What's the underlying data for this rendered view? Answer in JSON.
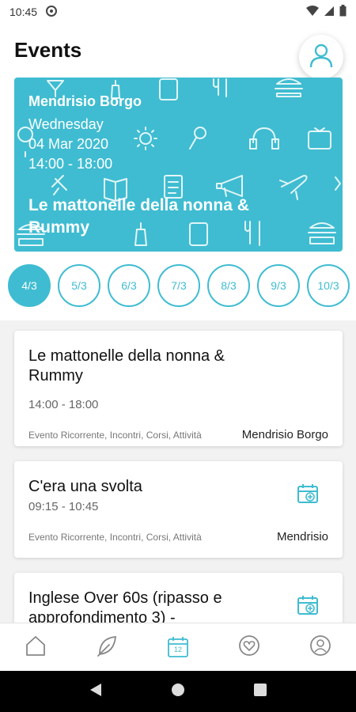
{
  "status_bar": {
    "time": "10:45"
  },
  "header": {
    "title": "Events"
  },
  "hero": {
    "location": "Mendrisio Borgo",
    "weekday": "Wednesday",
    "date": "04 Mar 2020",
    "time": "14:00 - 18:00",
    "title": "Le mattonelle della nonna & Rummy"
  },
  "dates": [
    "4/3",
    "5/3",
    "6/3",
    "7/3",
    "8/3",
    "9/3",
    "10/3"
  ],
  "events": [
    {
      "title": "Le mattonelle della nonna & Rummy",
      "time": "14:00 - 18:00",
      "tags": "Evento Ricorrente, Incontri, Corsi, Attività",
      "place": "Mendrisio Borgo"
    },
    {
      "title": "C'era una svolta",
      "time": "09:15 - 10:45",
      "tags": "Evento Ricorrente, Incontri, Corsi, Attività",
      "place": "Mendrisio"
    },
    {
      "title": "Inglese Over 60s (ripasso e approfondimento 3) -"
    }
  ],
  "bottom_nav": {
    "items": [
      "home-icon",
      "leaf-icon",
      "calendar-icon",
      "heart-icon",
      "profile-icon"
    ],
    "active_index": 2,
    "calendar_day": "12"
  },
  "colors": {
    "accent": "#3fbcd1",
    "nav_inactive": "#888888"
  }
}
